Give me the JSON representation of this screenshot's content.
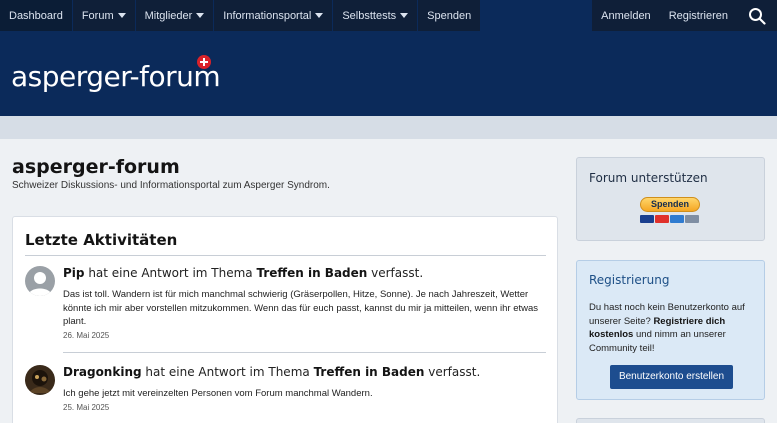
{
  "nav": {
    "items": [
      {
        "label": "Dashboard",
        "dropdown": false,
        "active": true
      },
      {
        "label": "Forum",
        "dropdown": true
      },
      {
        "label": "Mitglieder",
        "dropdown": true
      },
      {
        "label": "Informationsportal",
        "dropdown": true
      },
      {
        "label": "Selbsttests",
        "dropdown": true
      },
      {
        "label": "Spenden",
        "dropdown": false
      }
    ],
    "login": "Anmelden",
    "register": "Registrieren",
    "search_icon": "search-icon"
  },
  "header": {
    "logo_text": "asperger-forum",
    "logo_badge_icon": "swiss-cross-icon"
  },
  "main": {
    "title": "asperger-forum",
    "description": "Schweizer Diskussions- und Informationsportal zum Asperger Syndrom.",
    "activity": {
      "heading": "Letzte Aktivitäten",
      "posts": [
        {
          "user": "Pip",
          "middle": " hat eine Antwort im Thema ",
          "thread": "Treffen in Baden",
          "end": " verfasst.",
          "body": "Das ist toll. Wandern ist für mich manchmal schwierig (Gräserpollen, Hitze, Sonne). Je nach Jahreszeit, Wetter könnte ich mir aber vorstellen mitzukommen. Wenn das für euch passt, kannst du mir ja mitteilen, wenn ihr etwas plant.",
          "date": "26. Mai 2025"
        },
        {
          "user": "Dragonking",
          "middle": " hat eine Antwort im Thema ",
          "thread": "Treffen in Baden",
          "end": " verfasst.",
          "body": "Ich gehe jetzt mit vereinzelten Personen vom Forum manchmal Wandern.",
          "date": "25. Mai 2025"
        }
      ]
    }
  },
  "sidebar": {
    "support": {
      "title": "Forum unterstützen",
      "donate_label": "Spenden"
    },
    "registration": {
      "title": "Registrierung",
      "text_before": "Du hast noch kein Benutzerkonto auf unserer Seite? ",
      "text_bold": "Registriere dich kostenlos",
      "text_after": " und nimm an unserer Community teil!",
      "button": "Benutzerkonto erstellen"
    }
  },
  "colors": {
    "nav_bg": "#0b2a5a",
    "accent": "#1d4d8f",
    "logo_badge": "#d9222a"
  }
}
